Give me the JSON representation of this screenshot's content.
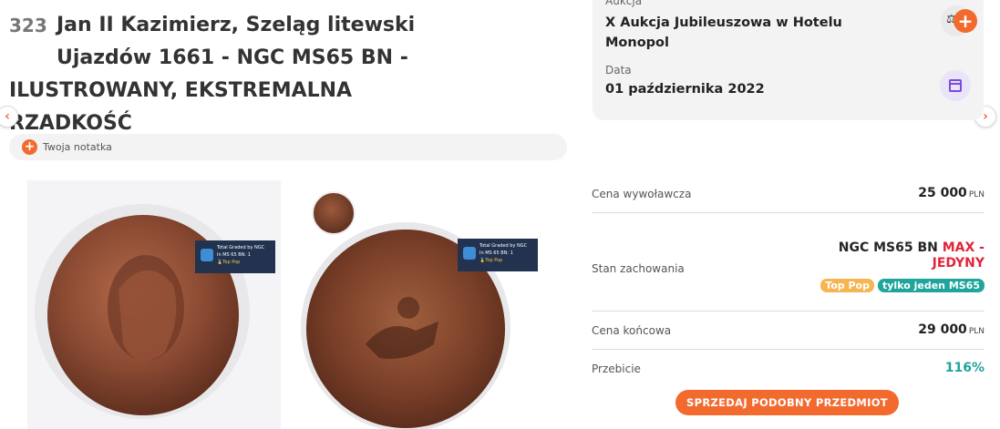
{
  "lot": {
    "number": "323",
    "title_line1": "Jan II Kazimierz, Szeląg litewski",
    "title_line2": "Ujazdów 1661 - NGC MS65 BN -",
    "title_line3": "ILUSTROWANY, EKSTREMALNA",
    "title_line4": "RZADKOŚĆ"
  },
  "note": {
    "label": "Twoja notatka",
    "icon": "plus-icon"
  },
  "ngc_tag": {
    "line1": "Total Graded by NGC",
    "line2": "In MS 65 BN: 1",
    "line3": "🏅Top Pop"
  },
  "auction": {
    "auction_label": "Aukcja",
    "auction_name_line1": "X Aukcja Jubileuszowa w Hotelu",
    "auction_name_line2": "Monopol",
    "date_label": "Data",
    "date_value": "01 października 2022"
  },
  "details": {
    "start_price_label": "Cena wywoławcza",
    "start_price_value": "25 000",
    "currency": "PLN",
    "condition_label": "Stan zachowania",
    "grade_text": "NGC MS65 BN",
    "grade_highlight_line1": "MAX -",
    "grade_highlight_line2": "JEDYNY",
    "badge_top_pop": "Top Pop",
    "badge_only": "tylko jeden MS65",
    "final_price_label": "Cena końcowa",
    "final_price_value": "29 000",
    "overbid_label": "Przebicie",
    "overbid_value": "116%"
  },
  "sell_button": "SPRZEDAJ PODOBNY PRZEDMIOT",
  "colors": {
    "accent": "#f26a2e",
    "teal": "#1fa59b",
    "red": "#e0263a",
    "purple": "#7b4ae2"
  }
}
